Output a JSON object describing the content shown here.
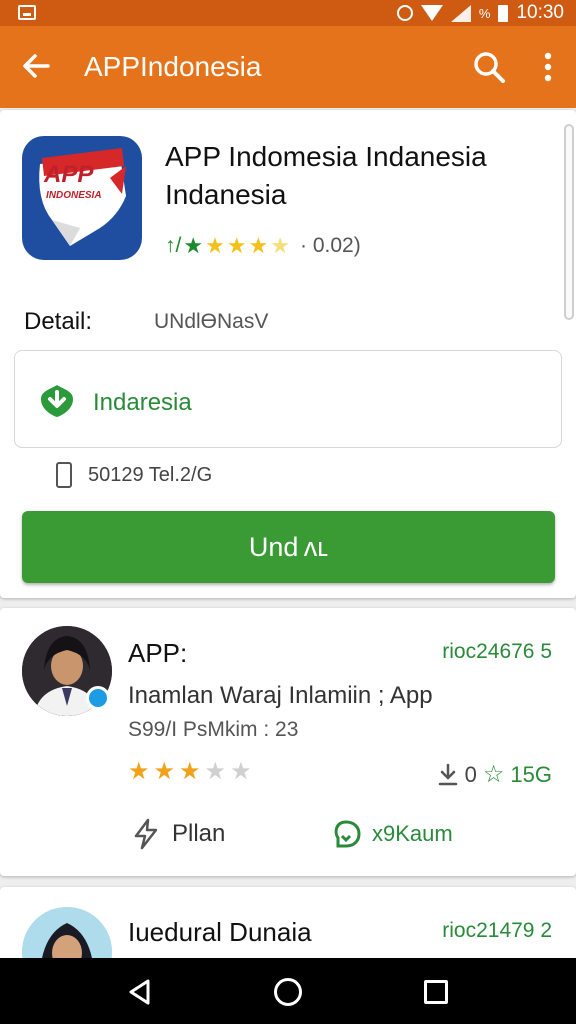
{
  "status_bar": {
    "time": "10:30",
    "battery_label": "%"
  },
  "app_bar": {
    "title": "APPIndonesia",
    "icons": [
      "back-arrow-icon",
      "search-icon",
      "more-vert-icon"
    ],
    "color": "#e5731c"
  },
  "app": {
    "name": "APP Indomesia Indanesia Indanesia",
    "icon_text_1": "APP",
    "icon_text_2": "INDONESIA",
    "rating_count": "· 0.02)",
    "rating_prefix": "↑/",
    "detail_label": "Detail:",
    "detail_value": "UNdlӨNasV",
    "category": "Indaresia",
    "size_text": "50129 Tel.2/G",
    "download_label": "Und ᴧʟ"
  },
  "reviews": [
    {
      "name": "APP:",
      "date": "rioc24676 5",
      "text": "Inamlan Waraj Inlamiin ; App",
      "meta": "S99/I PsMkim : 23",
      "rating": 3,
      "stat_downloads": "0",
      "stat_score": "15G",
      "action_left": "Pllan",
      "action_right": "x9Kaum"
    },
    {
      "name": "Iuedural Dunaia",
      "date": "rioc21479 2"
    }
  ],
  "colors": {
    "accent": "#e5731c",
    "green": "#3a9a34",
    "status": "#cf5a12"
  }
}
